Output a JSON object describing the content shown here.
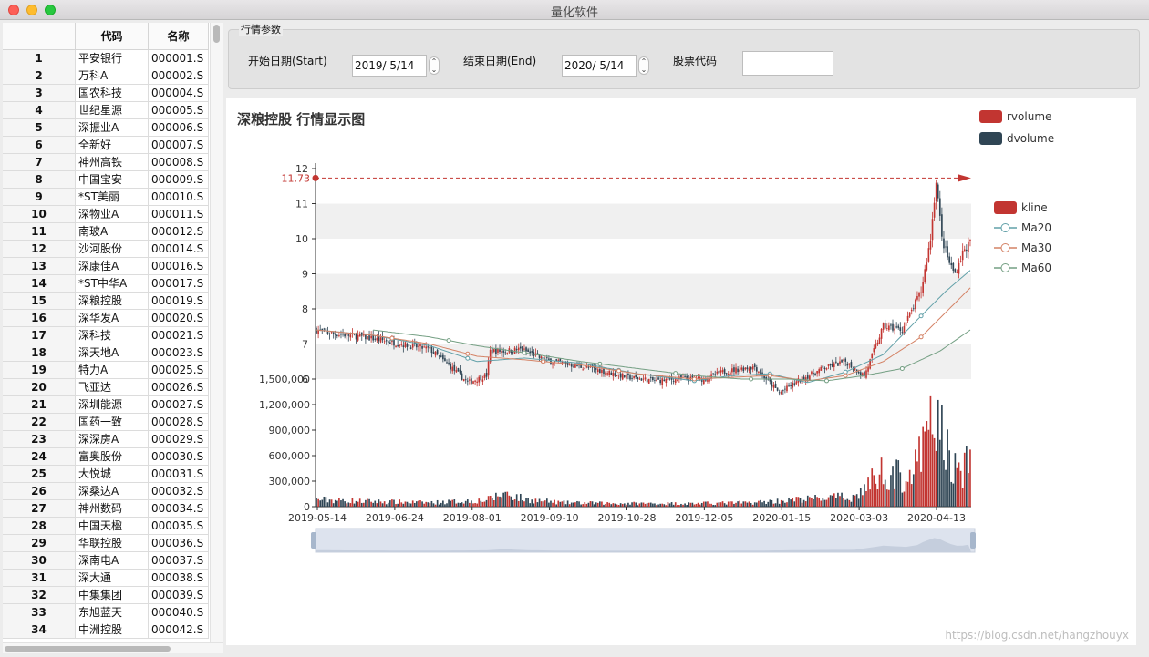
{
  "window": {
    "title": "量化软件"
  },
  "table": {
    "headers": [
      "",
      "代码",
      "名称"
    ],
    "rows": [
      [
        "1",
        "平安银行",
        "000001.S"
      ],
      [
        "2",
        "万科A",
        "000002.S"
      ],
      [
        "3",
        "国农科技",
        "000004.S"
      ],
      [
        "4",
        "世纪星源",
        "000005.S"
      ],
      [
        "5",
        "深振业A",
        "000006.S"
      ],
      [
        "6",
        "全新好",
        "000007.S"
      ],
      [
        "7",
        "神州高铁",
        "000008.S"
      ],
      [
        "8",
        "中国宝安",
        "000009.S"
      ],
      [
        "9",
        "*ST美丽",
        "000010.S"
      ],
      [
        "10",
        "深物业A",
        "000011.S"
      ],
      [
        "11",
        "南玻A",
        "000012.S"
      ],
      [
        "12",
        "沙河股份",
        "000014.S"
      ],
      [
        "13",
        "深康佳A",
        "000016.S"
      ],
      [
        "14",
        "*ST中华A",
        "000017.S"
      ],
      [
        "15",
        "深粮控股",
        "000019.S"
      ],
      [
        "16",
        "深华发A",
        "000020.S"
      ],
      [
        "17",
        "深科技",
        "000021.S"
      ],
      [
        "18",
        "深天地A",
        "000023.S"
      ],
      [
        "19",
        "特力A",
        "000025.S"
      ],
      [
        "20",
        "飞亚达",
        "000026.S"
      ],
      [
        "21",
        "深圳能源",
        "000027.S"
      ],
      [
        "22",
        "国药一致",
        "000028.S"
      ],
      [
        "23",
        "深深房A",
        "000029.S"
      ],
      [
        "24",
        "富奥股份",
        "000030.S"
      ],
      [
        "25",
        "大悦城",
        "000031.S"
      ],
      [
        "26",
        "深桑达A",
        "000032.S"
      ],
      [
        "27",
        "神州数码",
        "000034.S"
      ],
      [
        "28",
        "中国天楹",
        "000035.S"
      ],
      [
        "29",
        "华联控股",
        "000036.S"
      ],
      [
        "30",
        "深南电A",
        "000037.S"
      ],
      [
        "31",
        "深大通",
        "000038.S"
      ],
      [
        "32",
        "中集集团",
        "000039.S"
      ],
      [
        "33",
        "东旭蓝天",
        "000040.S"
      ],
      [
        "34",
        "中洲控股",
        "000042.S"
      ]
    ]
  },
  "params": {
    "group_title": "行情参数",
    "start_label": "开始日期(Start)",
    "start_value": "2019/  5/14",
    "end_label": "结束日期(End)",
    "end_value": "2020/  5/14",
    "code_label": "股票代码",
    "code_value": ""
  },
  "watermark": "https://blog.csdn.net/hangzhouyx",
  "chart_data": {
    "type": "candlestick+line+bar",
    "title": "深粮控股 行情显示图",
    "legend_volume": [
      "rvolume",
      "dvolume"
    ],
    "legend_price": [
      "kline",
      "Ma20",
      "Ma30",
      "Ma60"
    ],
    "colors": {
      "up": "#c23531",
      "down": "#2f4554",
      "ma20": "#61a0a8",
      "ma30": "#d48265",
      "ma60": "#749f83",
      "band": "#f0f0f0",
      "axis": "#333333"
    },
    "price_axis": {
      "min": 6,
      "max": 12,
      "ticks": [
        6,
        7,
        8,
        9,
        10,
        11,
        12
      ]
    },
    "volume_axis": {
      "min": 0,
      "max": 1500000,
      "ticks": [
        "0",
        "300,000",
        "600,000",
        "900,000",
        "1,200,000",
        "1,500,000"
      ]
    },
    "x_labels": [
      "2019-05-14",
      "2019-06-24",
      "2019-08-01",
      "2019-09-10",
      "2019-10-28",
      "2019-12-05",
      "2020-01-15",
      "2020-03-03",
      "2020-04-13"
    ],
    "max_mark": {
      "label": "11.73",
      "value": 11.73
    },
    "close_anchors": [
      [
        0,
        7.4
      ],
      [
        8,
        7.3
      ],
      [
        25,
        7.2
      ],
      [
        45,
        7.0
      ],
      [
        60,
        6.85
      ],
      [
        72,
        6.3
      ],
      [
        80,
        5.9
      ],
      [
        90,
        6.1
      ],
      [
        92,
        6.8
      ],
      [
        100,
        6.8
      ],
      [
        108,
        6.85
      ],
      [
        115,
        6.7
      ],
      [
        120,
        6.55
      ],
      [
        135,
        6.4
      ],
      [
        150,
        6.25
      ],
      [
        165,
        6.05
      ],
      [
        180,
        5.95
      ],
      [
        190,
        6.0
      ],
      [
        205,
        6.0
      ],
      [
        215,
        6.2
      ],
      [
        225,
        6.3
      ],
      [
        232,
        6.35
      ],
      [
        238,
        6.0
      ],
      [
        245,
        5.6
      ],
      [
        255,
        5.95
      ],
      [
        268,
        6.3
      ],
      [
        280,
        6.5
      ],
      [
        290,
        6.1
      ],
      [
        300,
        7.5
      ],
      [
        310,
        7.4
      ],
      [
        320,
        8.5
      ],
      [
        325,
        10.0
      ],
      [
        328,
        11.7
      ],
      [
        331,
        10.0
      ],
      [
        335,
        9.3
      ],
      [
        338,
        9.0
      ],
      [
        342,
        9.6
      ],
      [
        346,
        9.9
      ]
    ],
    "ma20_anchors": [
      [
        0,
        7.4
      ],
      [
        30,
        7.25
      ],
      [
        60,
        6.95
      ],
      [
        85,
        6.5
      ],
      [
        110,
        6.6
      ],
      [
        140,
        6.45
      ],
      [
        170,
        6.15
      ],
      [
        200,
        5.95
      ],
      [
        220,
        6.1
      ],
      [
        240,
        6.15
      ],
      [
        260,
        5.9
      ],
      [
        280,
        6.2
      ],
      [
        300,
        6.7
      ],
      [
        320,
        7.8
      ],
      [
        333,
        8.5
      ],
      [
        346,
        9.1
      ]
    ],
    "ma30_anchors": [
      [
        0,
        7.4
      ],
      [
        30,
        7.25
      ],
      [
        60,
        7.0
      ],
      [
        85,
        6.65
      ],
      [
        110,
        6.55
      ],
      [
        140,
        6.4
      ],
      [
        170,
        6.15
      ],
      [
        200,
        6.0
      ],
      [
        220,
        6.05
      ],
      [
        240,
        6.1
      ],
      [
        260,
        5.95
      ],
      [
        280,
        6.1
      ],
      [
        300,
        6.5
      ],
      [
        320,
        7.2
      ],
      [
        333,
        7.9
      ],
      [
        346,
        8.6
      ]
    ],
    "ma60_anchors": [
      [
        30,
        7.4
      ],
      [
        60,
        7.2
      ],
      [
        85,
        6.95
      ],
      [
        110,
        6.75
      ],
      [
        140,
        6.5
      ],
      [
        170,
        6.3
      ],
      [
        200,
        6.1
      ],
      [
        225,
        6.0
      ],
      [
        250,
        6.0
      ],
      [
        270,
        5.95
      ],
      [
        290,
        6.1
      ],
      [
        310,
        6.3
      ],
      [
        330,
        6.8
      ],
      [
        346,
        7.4
      ]
    ],
    "volume_anchors": [
      [
        0,
        90000
      ],
      [
        20,
        70000
      ],
      [
        40,
        60000
      ],
      [
        60,
        50000
      ],
      [
        90,
        80000
      ],
      [
        100,
        170000
      ],
      [
        110,
        90000
      ],
      [
        130,
        50000
      ],
      [
        160,
        40000
      ],
      [
        200,
        40000
      ],
      [
        230,
        50000
      ],
      [
        250,
        80000
      ],
      [
        270,
        110000
      ],
      [
        285,
        120000
      ],
      [
        300,
        450000
      ],
      [
        312,
        350000
      ],
      [
        318,
        500000
      ],
      [
        322,
        800000
      ],
      [
        328,
        1100000
      ],
      [
        335,
        600000
      ],
      [
        340,
        400000
      ],
      [
        346,
        550000
      ]
    ],
    "n_bars": 347,
    "zoom_slider": {
      "start": 0,
      "end": 100
    }
  }
}
